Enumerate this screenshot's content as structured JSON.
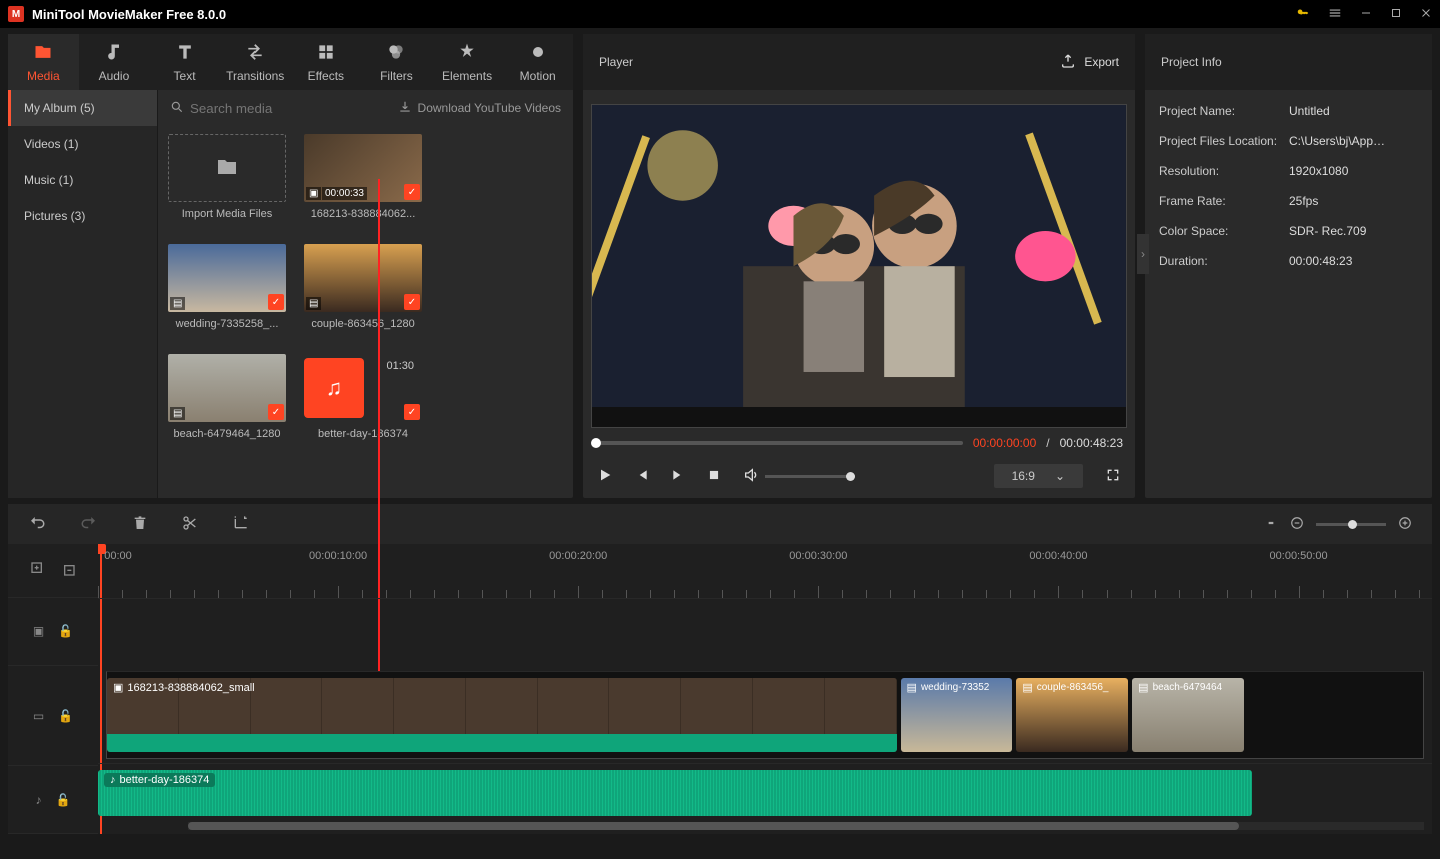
{
  "titlebar": {
    "title": "MiniTool MovieMaker Free 8.0.0"
  },
  "tabs": [
    {
      "label": "Media"
    },
    {
      "label": "Audio"
    },
    {
      "label": "Text"
    },
    {
      "label": "Transitions"
    },
    {
      "label": "Effects"
    },
    {
      "label": "Filters"
    },
    {
      "label": "Elements"
    },
    {
      "label": "Motion"
    }
  ],
  "sidebar": {
    "items": [
      {
        "label": "My Album (5)"
      },
      {
        "label": "Videos (1)"
      },
      {
        "label": "Music (1)"
      },
      {
        "label": "Pictures (3)"
      }
    ]
  },
  "mediaToolbar": {
    "searchPlaceholder": "Search media",
    "downloadLabel": "Download YouTube Videos"
  },
  "mediaItems": {
    "import": "Import Media Files",
    "v1": {
      "name": "168213-838884062...",
      "dur": "00:00:33"
    },
    "p1": {
      "name": "wedding-7335258_..."
    },
    "p2": {
      "name": "couple-863456_1280"
    },
    "p3": {
      "name": "beach-6479464_1280"
    },
    "m1": {
      "name": "better-day-186374",
      "dur": "01:30"
    }
  },
  "player": {
    "label": "Player",
    "export": "Export",
    "current": "00:00:00:00",
    "total": "00:00:48:23",
    "ratio": "16:9"
  },
  "project": {
    "title": "Project Info",
    "rows": [
      {
        "k": "Project Name:",
        "v": "Untitled"
      },
      {
        "k": "Project Files Location:",
        "v": "C:\\Users\\bj\\App…"
      },
      {
        "k": "Resolution:",
        "v": "1920x1080"
      },
      {
        "k": "Frame Rate:",
        "v": "25fps"
      },
      {
        "k": "Color Space:",
        "v": "SDR- Rec.709"
      },
      {
        "k": "Duration:",
        "v": "00:00:48:23"
      }
    ]
  },
  "ruler": [
    "00:00",
    "00:00:10:00",
    "00:00:20:00",
    "00:00:30:00",
    "00:00:40:00",
    "00:00:50:00"
  ],
  "clips": {
    "v1": "168213-838884062_small",
    "p1": "wedding-73352",
    "p2": "couple-863456_",
    "p3": "beach-6479464",
    "a1": "better-day-186374"
  }
}
